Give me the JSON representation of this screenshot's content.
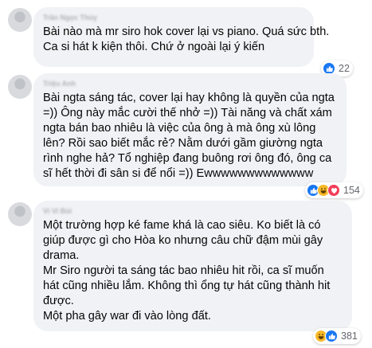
{
  "comments": [
    {
      "author": "Trần Ngọc Thủy",
      "lines": [
        "Bài nào mà mr siro hok cover lại vs piano. Quá sức bth.",
        "Ca si hát k kiện thôi. Chứ ở ngoài lại ý kiến"
      ],
      "reaction_count": "22"
    },
    {
      "author": "Triệu Anh",
      "lines": [
        "Bài ngta sáng tác, cover lại hay không là quyền của ngta",
        "=)) Ông này mắc cười thế nhở =)) Tài năng và chất xám",
        "ngta bán bao nhiêu là việc của ông à mà ông xù lông",
        "lên? Rồi sao biết mắc rẻ? Nằm dưới gầm giường ngta",
        "rình nghe hả? Tổ nghiệp đang buông rơi ông đó, ông ca",
        "sĩ hết thời đi sân si để nổi =)) Ewwwwwwwwwwwww"
      ],
      "reaction_count": "154"
    },
    {
      "author": "Vi Vi Bùi",
      "lines": [
        "Một trường hợp ké fame khá là cao siêu. Ko biết là có",
        "giúp được gì cho Hòa ko nhưng câu chữ đậm mùi gây",
        "drama.",
        "Mr Siro người ta sáng tác bao nhiêu hit rồi, ca sĩ muốn",
        "hát cũng nhiều lắm. Không thì ổng tự hát cũng thành hit",
        "được.",
        "Một pha gây war đi vào lòng đất."
      ],
      "reaction_count": "381"
    }
  ],
  "colors": {
    "bubble": "#f0f2f5",
    "like": "#1877f2",
    "haha": "#f7b928",
    "love": "#f33e58"
  }
}
